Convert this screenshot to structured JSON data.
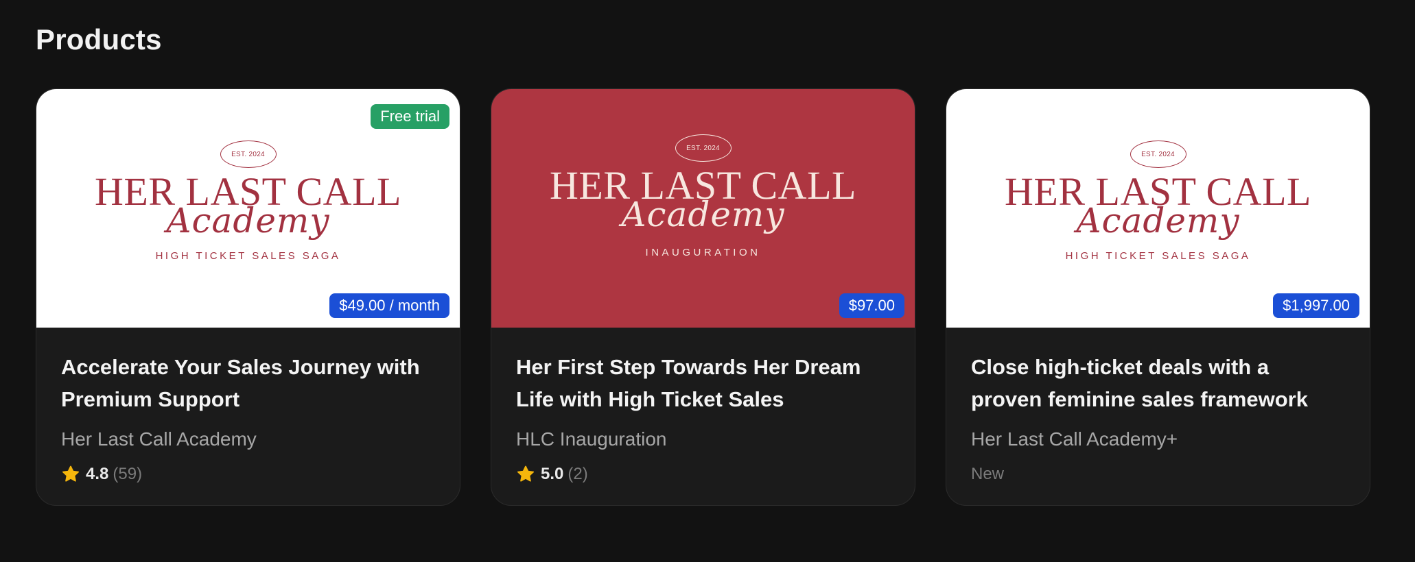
{
  "section_title": "Products",
  "colors": {
    "background": "#121212",
    "card": "#1b1b1b",
    "price_badge": "#1b4fd6",
    "trial_badge": "#27a065",
    "brand_red": "#ae3641",
    "star": "#f5b60c"
  },
  "products": [
    {
      "thumbnail": {
        "est": "EST. 2024",
        "brand": "HER LAST CALL",
        "script": "Academy",
        "tagline": "HIGH TICKET SALES SAGA"
      },
      "trial_badge": "Free trial",
      "price": "$49.00 / month",
      "title": "Accelerate Your Sales Journey with Premium Support",
      "author": "Her Last Call Academy",
      "rating": "4.8",
      "rating_count": "(59)"
    },
    {
      "thumbnail": {
        "est": "EST. 2024",
        "brand": "HER LAST CALL",
        "script": "Academy",
        "tagline": "INAUGURATION"
      },
      "price": "$97.00",
      "title": "Her First Step Towards Her Dream Life with High Ticket Sales",
      "author": "HLC Inauguration",
      "rating": "5.0",
      "rating_count": "(2)"
    },
    {
      "thumbnail": {
        "est": "EST. 2024",
        "brand": "HER LAST CALL",
        "script": "Academy",
        "tagline": "HIGH TICKET SALES SAGA"
      },
      "price": "$1,997.00",
      "title": "Close high-ticket deals with a proven feminine sales framework",
      "author": "Her Last Call Academy+",
      "status": "New"
    }
  ]
}
